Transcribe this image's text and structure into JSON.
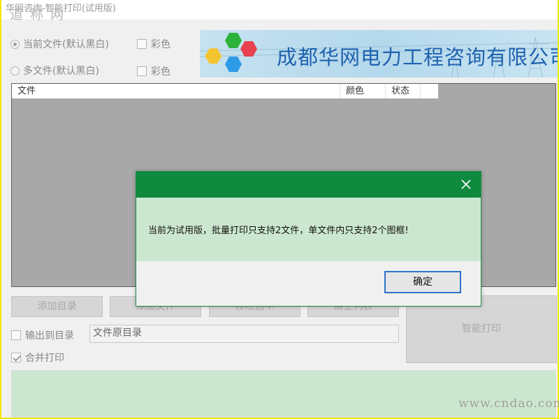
{
  "window": {
    "title": "华网咨询-智能打印(试用版)",
    "watermark_top": "道 称 网",
    "watermark_bottom": "www.cndao.com"
  },
  "options": {
    "current_file_label": "当前文件(默认黑白)",
    "multi_file_label": "多文件(默认黑白)",
    "color_label": "彩色",
    "color_label_2": "彩色",
    "output_to_dir_label": "输出到目录",
    "merge_print_label": "合并打印"
  },
  "banner": {
    "company_name": "成都华网电力工程咨询有限公司"
  },
  "file_list": {
    "columns": [
      "文件",
      "颜色",
      "状态"
    ]
  },
  "buttons": {
    "add_dir": "添加目录",
    "add_file": "添加文件",
    "remove_selected": "移除选中",
    "clear_list": "清空列表",
    "smart_print": "智能打印"
  },
  "output_path": {
    "value": "文件原目录"
  },
  "dialog": {
    "message": "当前为试用版，批量打印只支持2文件，单文件内只支持2个图框!",
    "ok_label": "确定"
  },
  "colors": {
    "dialog_header": "#108a3f",
    "dialog_body": "#cce7cf",
    "banner_text": "#1f62b0",
    "frame_border": "#f2e600"
  }
}
